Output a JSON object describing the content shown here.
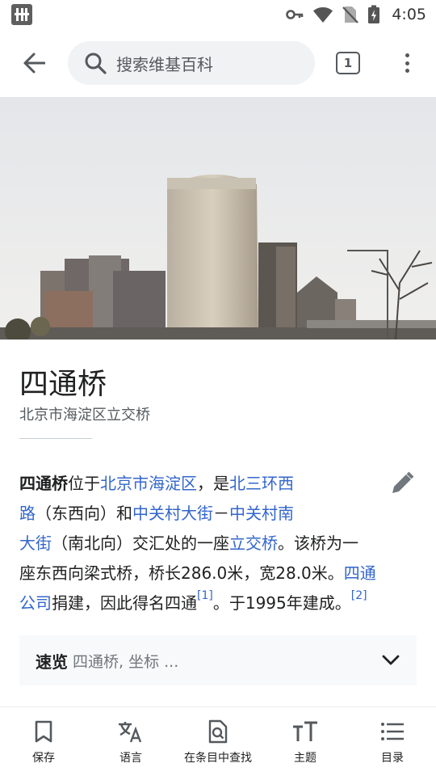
{
  "status_bar": {
    "time": "4:05",
    "icons": [
      "app-notification-icon",
      "key-icon",
      "wifi-icon",
      "no-sim-icon",
      "battery-charging-icon"
    ]
  },
  "toolbar": {
    "back_icon": "arrow-back-icon",
    "search_placeholder": "搜索维基百科",
    "tabs_count": "1",
    "menu_icon": "more-vert-icon"
  },
  "article": {
    "title": "四通桥",
    "description": "北京市海淀区立交桥",
    "lines": [
      [
        {
          "t": "四通桥",
          "b": true
        },
        {
          "t": "位于"
        },
        {
          "t": "北京市海淀区",
          "l": true
        },
        {
          "t": "，是"
        },
        {
          "t": "北三环西",
          "l": true
        }
      ],
      [
        {
          "t": "路",
          "l": true
        },
        {
          "t": "（东西向）和"
        },
        {
          "t": "中关村大街",
          "l": true
        },
        {
          "t": "－"
        },
        {
          "t": "中关村南",
          "l": true
        }
      ],
      [
        {
          "t": "大街",
          "l": true
        },
        {
          "t": "（南北向）交汇处的一座"
        },
        {
          "t": "立交桥",
          "l": true
        },
        {
          "t": "。该桥为一"
        }
      ],
      [
        {
          "t": "座东西向梁式桥，桥长286.0米，宽28.0米。"
        },
        {
          "t": "四通",
          "l": true
        }
      ],
      [
        {
          "t": "公司",
          "l": true
        },
        {
          "t": "捐建，因此得名四通"
        },
        {
          "t": "[1]",
          "s": true
        },
        {
          "t": "。于1995年建成。"
        },
        {
          "t": "[2]",
          "s": true
        }
      ]
    ],
    "quickfacts_label": "速览",
    "quickfacts_summary": "四通桥, 坐标 ..."
  },
  "bottom_nav": [
    {
      "label": "保存",
      "icon": "bookmark-icon"
    },
    {
      "label": "语言",
      "icon": "translate-icon"
    },
    {
      "label": "在条目中查找",
      "icon": "find-in-page-icon"
    },
    {
      "label": "主题",
      "icon": "text-format-icon"
    },
    {
      "label": "目录",
      "icon": "list-icon"
    }
  ],
  "colors": {
    "link": "#3366cc",
    "text": "#202122",
    "secondary": "#54595d",
    "search_bg": "#f1f2f4",
    "quickfacts_bg": "#f8f9fa"
  }
}
